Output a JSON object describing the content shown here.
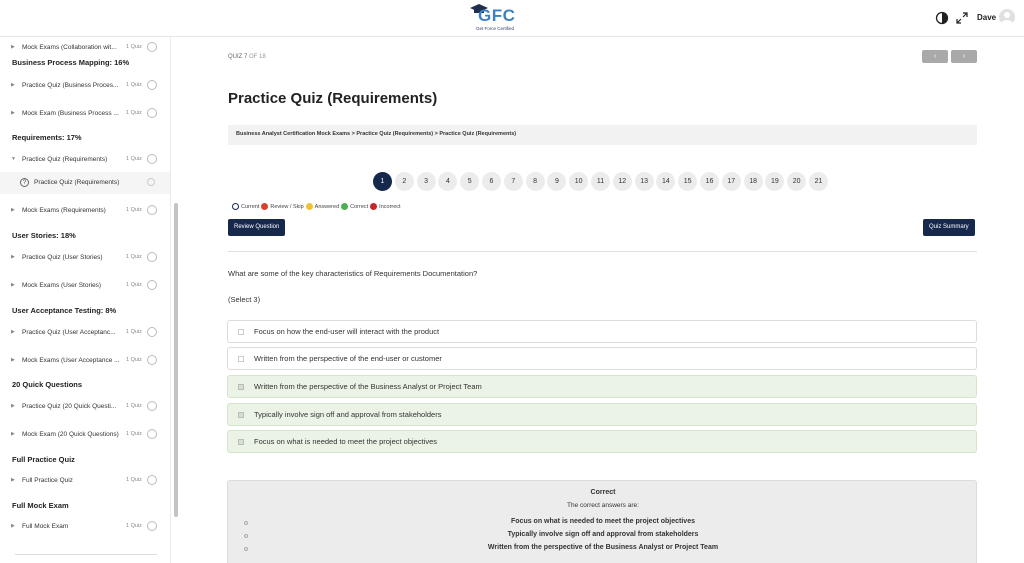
{
  "header": {
    "logo_text": "GFC",
    "logo_tagline": "Get Force Certified",
    "user_name": "Dave"
  },
  "sidebar": {
    "items": [
      {
        "type": "item",
        "label": "Mock Exams (Collaboration wit...",
        "count": "1 Quiz"
      },
      {
        "type": "section",
        "label": "Business Process Mapping: 16%"
      },
      {
        "type": "item",
        "label": "Practice Quiz (Business Proces...",
        "count": "1 Quiz"
      },
      {
        "type": "item",
        "label": "Mock Exam (Business Process ...",
        "count": "1 Quiz"
      },
      {
        "type": "section",
        "label": "Requirements: 17%"
      },
      {
        "type": "item",
        "label": "Practice Quiz (Requirements)",
        "count": "1 Quiz",
        "expanded": true
      },
      {
        "type": "sub",
        "label": "Practice Quiz (Requirements)"
      },
      {
        "type": "item",
        "label": "Mock Exams (Requirements)",
        "count": "1 Quiz"
      },
      {
        "type": "section",
        "label": "User Stories: 18%"
      },
      {
        "type": "item",
        "label": "Practice Quiz (User Stories)",
        "count": "1 Quiz"
      },
      {
        "type": "item",
        "label": "Mock Exams (User Stories)",
        "count": "1 Quiz"
      },
      {
        "type": "section",
        "label": "User Acceptance Testing: 8%"
      },
      {
        "type": "item",
        "label": "Practice Quiz (User Acceptanc...",
        "count": "1 Quiz"
      },
      {
        "type": "item",
        "label": "Mock Exams (User Acceptance ...",
        "count": "1 Quiz"
      },
      {
        "type": "section",
        "label": "20 Quick Questions"
      },
      {
        "type": "item",
        "label": "Practice Quiz (20 Quick Questi...",
        "count": "1 Quiz"
      },
      {
        "type": "item",
        "label": "Mock Exam (20 Quick Questions)",
        "count": "1 Quiz"
      },
      {
        "type": "section",
        "label": "Full Practice Quiz"
      },
      {
        "type": "item",
        "label": "Full Practice Quiz",
        "count": "1 Quiz"
      },
      {
        "type": "section",
        "label": "Full Mock Exam"
      },
      {
        "type": "item",
        "label": "Full Mock Exam",
        "count": "1 Quiz"
      }
    ]
  },
  "main": {
    "quiz_label": "QUIZ 7",
    "quiz_of": "OF 18",
    "prev_label": "‹",
    "next_label": "›",
    "title": "Practice Quiz (Requirements)",
    "breadcrumb": "Business Analyst Certification Mock Exams > Practice Quiz (Requirements) > Practice Quiz (Requirements)",
    "pages": [
      "1",
      "2",
      "3",
      "4",
      "5",
      "6",
      "7",
      "8",
      "9",
      "10",
      "11",
      "12",
      "13",
      "14",
      "15",
      "16",
      "17",
      "18",
      "19",
      "20",
      "21"
    ],
    "active_page": "1",
    "legend": [
      {
        "label": "Current",
        "color": "#ffffff",
        "border": "#17284d"
      },
      {
        "label": "Review / Skip",
        "color": "#d9412b"
      },
      {
        "label": "Answered",
        "color": "#f1c232"
      },
      {
        "label": "Correct",
        "color": "#4caf50"
      },
      {
        "label": "Incorrect",
        "color": "#c62828"
      }
    ],
    "review_button": "Review Question",
    "summary_button": "Quiz Summary",
    "question": "What are some of the key characteristics of Requirements Documentation?",
    "select_hint": "(Select 3)",
    "options": [
      {
        "text": "Focus on how the end-user will interact with the product",
        "correct": false
      },
      {
        "text": "Written from the perspective of the end-user or customer",
        "correct": false
      },
      {
        "text": "Written from the perspective of the Business Analyst or Project Team",
        "correct": true
      },
      {
        "text": "Typically involve sign off and approval from stakeholders",
        "correct": true
      },
      {
        "text": "Focus on what is needed to meet the project objectives",
        "correct": true
      }
    ],
    "answer": {
      "title": "Correct",
      "subtitle": "The correct answers are:",
      "items": [
        "Focus on what is needed to meet the project objectives",
        "Typically involve sign off and approval from stakeholders",
        "Written from the perspective of the Business Analyst or Project Team"
      ]
    }
  }
}
